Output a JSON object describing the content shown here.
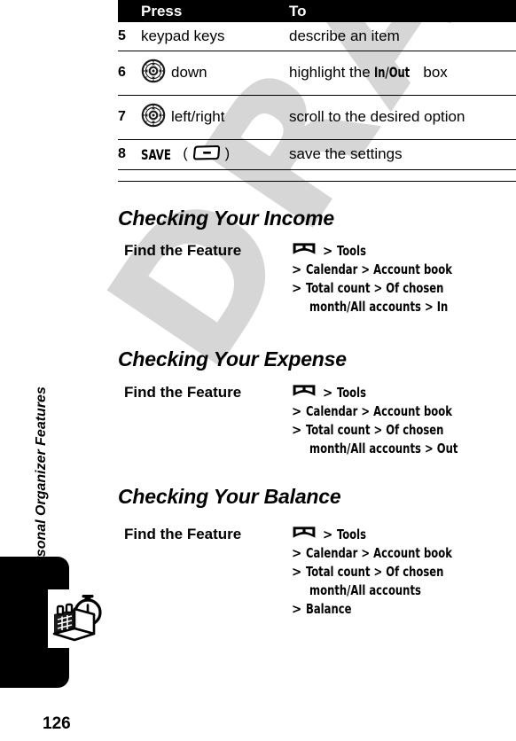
{
  "page": {
    "number": "126",
    "chapter_title": "Personal Organizer Features",
    "watermark": "DRAFT",
    "chapter_tab_icon": "calendar-stopwatch-icon"
  },
  "steps_table": {
    "columns": [
      "",
      "Press",
      "To"
    ],
    "rows": [
      {
        "num": "5",
        "press_text": "keypad keys",
        "press_icon": "",
        "to_prefix": "describe an item",
        "to_bold": "",
        "to_suffix": ""
      },
      {
        "num": "6",
        "press_text": "down",
        "press_icon": "navigation-key-icon",
        "to_prefix": "highlight the ",
        "to_bold": "In/Out",
        "to_suffix": " box"
      },
      {
        "num": "7",
        "press_text": "left/right",
        "press_icon": "navigation-key-icon",
        "to_prefix": "scroll to the desired option",
        "to_bold": "",
        "to_suffix": ""
      },
      {
        "num": "8",
        "press_text": "SAVE",
        "press_icon": "soft-key-icon",
        "press_paren_open": "(",
        "press_paren_close": ")",
        "to_prefix": "save the settings",
        "to_bold": "",
        "to_suffix": ""
      }
    ]
  },
  "sections": [
    {
      "heading": "Checking Your Income",
      "find_label": "Find the Feature",
      "menu_icon": "menu-key-icon",
      "path_lines": [
        {
          "chevron": ">",
          "text": "Tools",
          "indent": false,
          "first": true
        },
        {
          "chevron": ">",
          "text": "Calendar > Account book",
          "indent": false,
          "first": false
        },
        {
          "chevron": ">",
          "text": "Total count > Of chosen",
          "indent": false,
          "first": false
        },
        {
          "chevron": "",
          "text": "month/All accounts > In",
          "indent": true,
          "first": false
        }
      ]
    },
    {
      "heading": "Checking Your Expense",
      "find_label": "Find the Feature",
      "menu_icon": "menu-key-icon",
      "path_lines": [
        {
          "chevron": ">",
          "text": "Tools",
          "indent": false,
          "first": true
        },
        {
          "chevron": ">",
          "text": "Calendar > Account book",
          "indent": false,
          "first": false
        },
        {
          "chevron": ">",
          "text": "Total count > Of chosen",
          "indent": false,
          "first": false
        },
        {
          "chevron": "",
          "text": "month/All accounts > Out",
          "indent": true,
          "first": false
        }
      ]
    },
    {
      "heading": "Checking Your Balance",
      "find_label": "Find the Feature",
      "menu_icon": "menu-key-icon",
      "path_lines": [
        {
          "chevron": ">",
          "text": "Tools",
          "indent": false,
          "first": true
        },
        {
          "chevron": ">",
          "text": "Calendar > Account book",
          "indent": false,
          "first": false
        },
        {
          "chevron": ">",
          "text": "Total count > Of chosen",
          "indent": false,
          "first": false
        },
        {
          "chevron": "",
          "text": "month/All accounts",
          "indent": true,
          "first": false
        },
        {
          "chevron": ">",
          "text": "Balance",
          "indent": false,
          "first": false
        }
      ]
    }
  ],
  "colors": {
    "text": "#000000",
    "header_bg": "#000000",
    "header_text": "#ffffff",
    "watermark": "#d6d6d6",
    "page_bg": "#ffffff"
  }
}
